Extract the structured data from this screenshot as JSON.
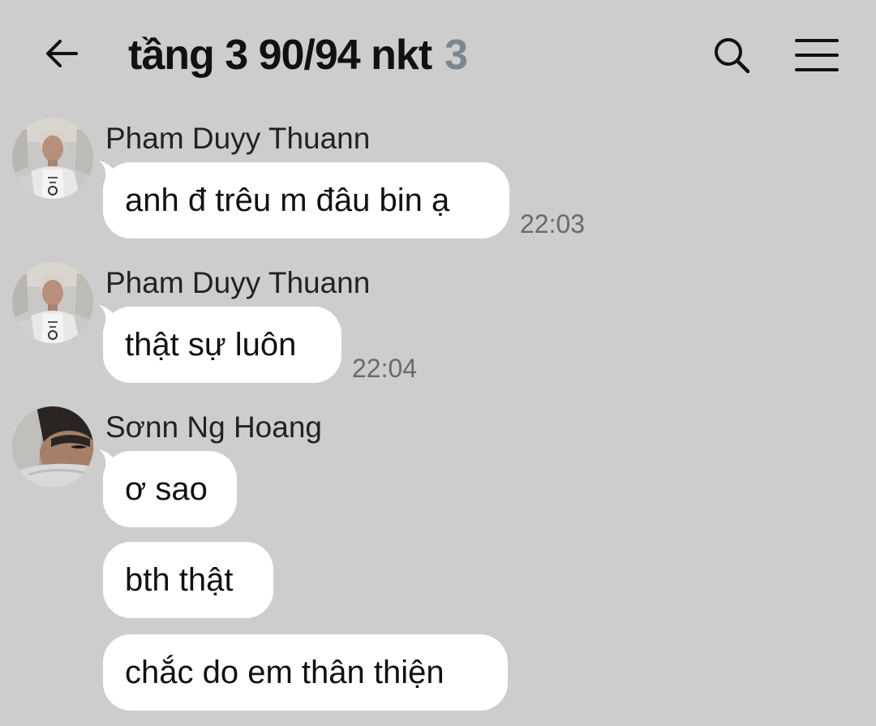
{
  "header": {
    "title": "tầng 3 90/94 nkt",
    "member_count": "3",
    "back_icon": "arrow-left-icon",
    "search_icon": "search-icon",
    "menu_icon": "hamburger-menu-icon"
  },
  "messages": [
    {
      "sender": "Pham Duyy Thuann",
      "bubbles": [
        "anh đ trêu m đâu bin ạ"
      ],
      "time": "22:03"
    },
    {
      "sender": "Pham Duyy Thuann",
      "bubbles": [
        "thật sự luôn"
      ],
      "time": "22:04"
    },
    {
      "sender": "Sơnn Ng Hoang",
      "bubbles": [
        "ơ sao",
        "bth thật",
        "chắc do em thân thiện"
      ],
      "time": ""
    }
  ],
  "colors": {
    "background": "#cdcdcd",
    "bubble": "#ffffff",
    "member_count": "#7b8691",
    "timestamp": "#6a6a6a"
  }
}
